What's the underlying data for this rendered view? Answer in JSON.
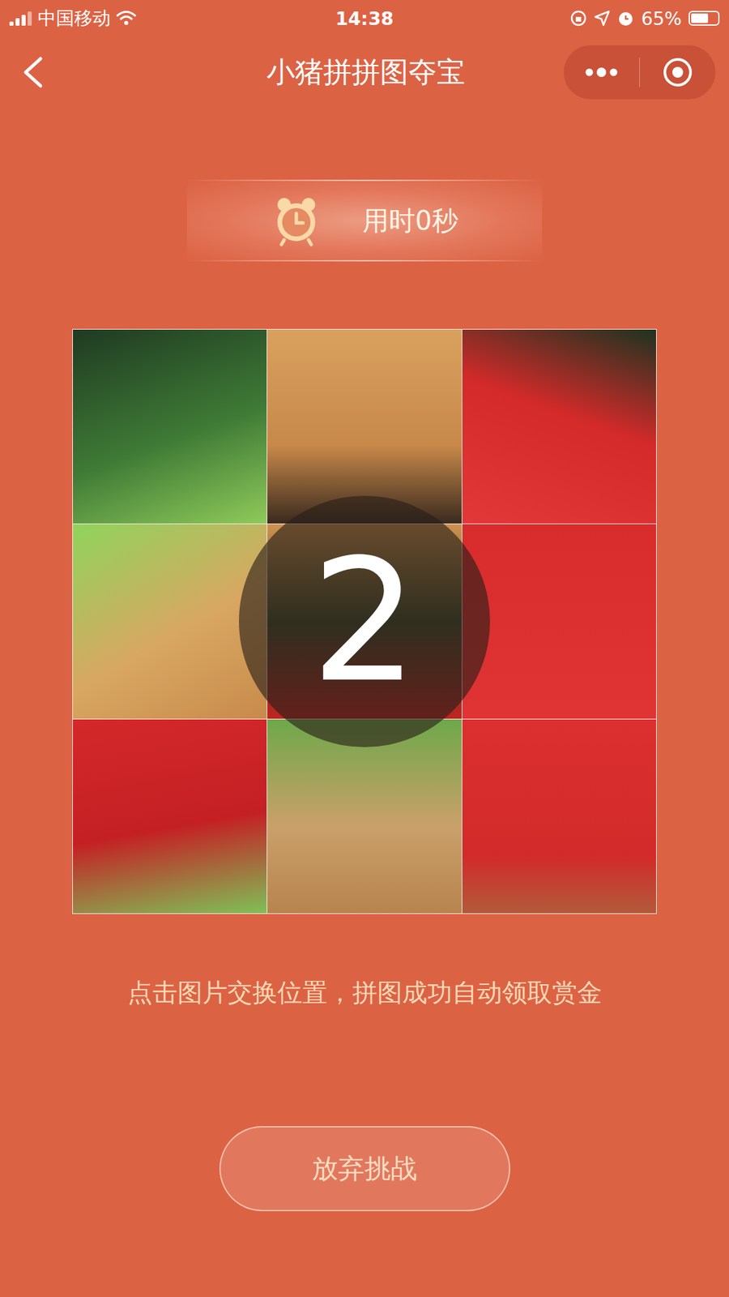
{
  "status_bar": {
    "carrier": "中国移动",
    "time": "14:38",
    "battery": "65%",
    "battery_level": 0.65
  },
  "nav": {
    "title": "小猪拼拼图夺宝"
  },
  "timer": {
    "label": "用时0秒"
  },
  "countdown": {
    "value": "2"
  },
  "hint": "点击图片交换位置，拼图成功自动领取赏金",
  "buttons": [
    "放弃挑战"
  ]
}
